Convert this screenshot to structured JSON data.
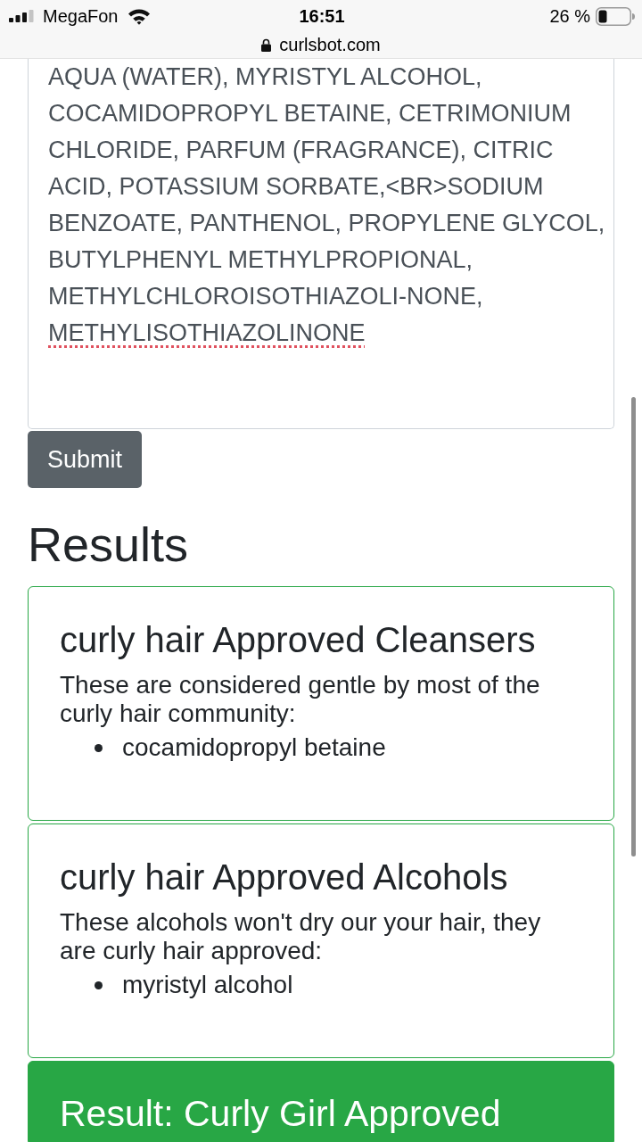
{
  "status_bar": {
    "carrier": "MegaFon",
    "time": "16:51",
    "battery": "26 %"
  },
  "address_bar": {
    "url": "curlsbot.com"
  },
  "ingredients_field": {
    "value": [
      {
        "text": "AQUA (WATER), MYRISTYL ALCOHOL, COCAMIDOPROPYL BETAINE, CETRIMONIUM CHLORIDE, PARFUM (FRAGRANCE), CITRIC ACID, POTASSIUM SORBATE,<BR>SODIUM BENZOATE, PANTHENOL, PROPYLENE GLYCOL, BUTYLPHENYL METHYLPROPIONAL, METHYLCHLOROISOTHIAZOLI-NONE,",
        "misspelled": false
      },
      {
        "text": "METHYLISOTHIAZOLINONE",
        "misspelled": true
      }
    ]
  },
  "submit_button": {
    "label": "Submit"
  },
  "results": {
    "heading": "Results",
    "cards": [
      {
        "kind": "list",
        "title": "curly hair Approved Cleansers",
        "description": "These are considered gentle by most of the curly hair community:",
        "items": [
          "cocamidopropyl betaine"
        ]
      },
      {
        "kind": "list",
        "title": "curly hair Approved Alcohols",
        "description": "These alcohols won't dry our your hair, they are curly hair approved:",
        "items": [
          "myristyl alcohol"
        ]
      },
      {
        "kind": "verdict",
        "title": "Result: Curly Girl Approved"
      }
    ]
  }
}
